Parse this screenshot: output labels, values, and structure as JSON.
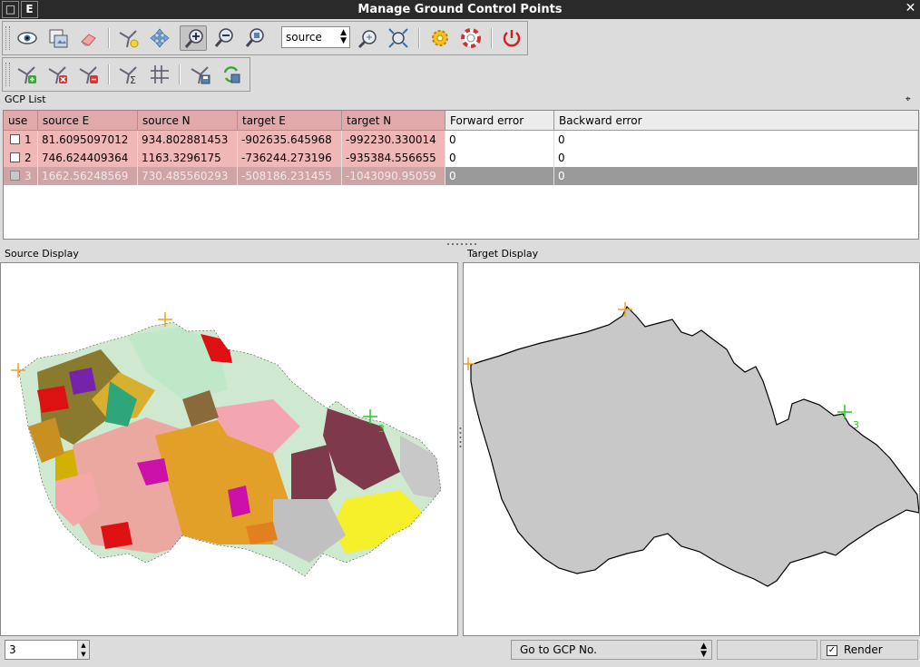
{
  "window": {
    "title": "Manage Ground Control Points",
    "menu_button_1": "□",
    "menu_button_2": "E",
    "close_glyph": "✕"
  },
  "toolbar": {
    "map_selector": "source",
    "buttons_row1": [
      "eye-icon",
      "open-raster-icon",
      "eraser-icon",
      "add-point-icon",
      "pan-icon",
      "zoom-in-icon",
      "zoom-out-icon",
      "zoom-layer-icon",
      "zoom-to-gcp-icon",
      "zoom-full-icon",
      "settings-icon",
      "help-icon",
      "quit-icon"
    ],
    "buttons_row2": [
      "add-gcp-icon",
      "delete-gcp-icon",
      "clear-gcp-icon",
      "calc-rms-icon",
      "grid-icon",
      "save-gcp-icon",
      "refresh-gcp-icon"
    ]
  },
  "gcp_list": {
    "title": "GCP List",
    "dock_glyph": "⌖",
    "columns": [
      "use",
      "source E",
      "source N",
      "target E",
      "target N",
      "Forward error",
      "Backward error"
    ],
    "rows": [
      {
        "n": "1",
        "source_e": "81.6095097012",
        "source_n": "934.802881453",
        "target_e": "-902635.645968",
        "target_n": "-992230.330014",
        "fwd": "0",
        "bwd": "0"
      },
      {
        "n": "2",
        "source_e": "746.624409364",
        "source_n": "1163.3296175",
        "target_e": "-736244.273196",
        "target_n": "-935384.556655",
        "fwd": "0",
        "bwd": "0"
      },
      {
        "n": "3",
        "source_e": "1662.56248569",
        "source_n": "730.485560293",
        "target_e": "-508186.231455",
        "target_n": "-1043090.95059",
        "fwd": "0",
        "bwd": "0"
      }
    ],
    "highlighted_row": 3
  },
  "source_display": {
    "title": "Source Display",
    "point_3_label": "3"
  },
  "target_display": {
    "title": "Target Display",
    "point_3_label": "3"
  },
  "statusbar": {
    "spin_value": "3",
    "spin_up": "▲",
    "spin_down": "▼",
    "goto_label": "Go to GCP No.",
    "combo_arrow": "▲▼",
    "render_label": "Render",
    "render_checked": "✓"
  },
  "colors": {
    "gcp_cross": "#f0a020",
    "gcp_cross_selected": "#22cc22",
    "country_fill": "#c8c8c8",
    "selected_columns": "#e1a9a9",
    "highlight_row": "#9a9a9a"
  }
}
